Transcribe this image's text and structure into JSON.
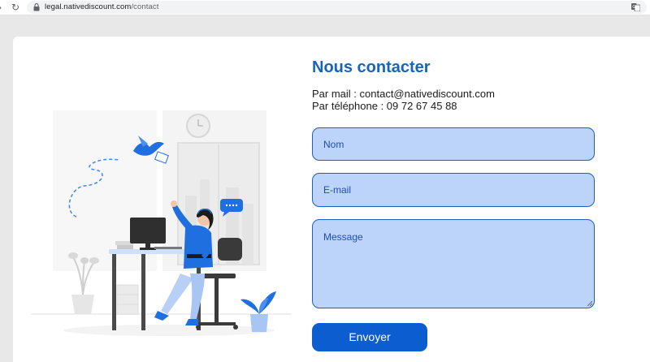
{
  "browser": {
    "url_domain": "legal.nativediscount.com",
    "url_path": "/contact"
  },
  "contact": {
    "title": "Nous contacter",
    "mail_line": "Par mail : contact@nativediscount.com",
    "phone_line": "Par téléphone : 09 72 67 45 88"
  },
  "form": {
    "name_placeholder": "Nom",
    "email_placeholder": "E-mail",
    "message_placeholder": "Message",
    "submit_label": "Envoyer"
  },
  "colors": {
    "title": "#1565c0",
    "field_fill": "#bcd3fa",
    "field_border": "#1e5fbf",
    "button": "#0c5ed0",
    "illustration_blue": "#1f6fe0"
  },
  "icons": {
    "forward": "forward-arrow-icon",
    "reload": "reload-icon",
    "lock": "lock-icon",
    "translate": "translate-icon"
  }
}
